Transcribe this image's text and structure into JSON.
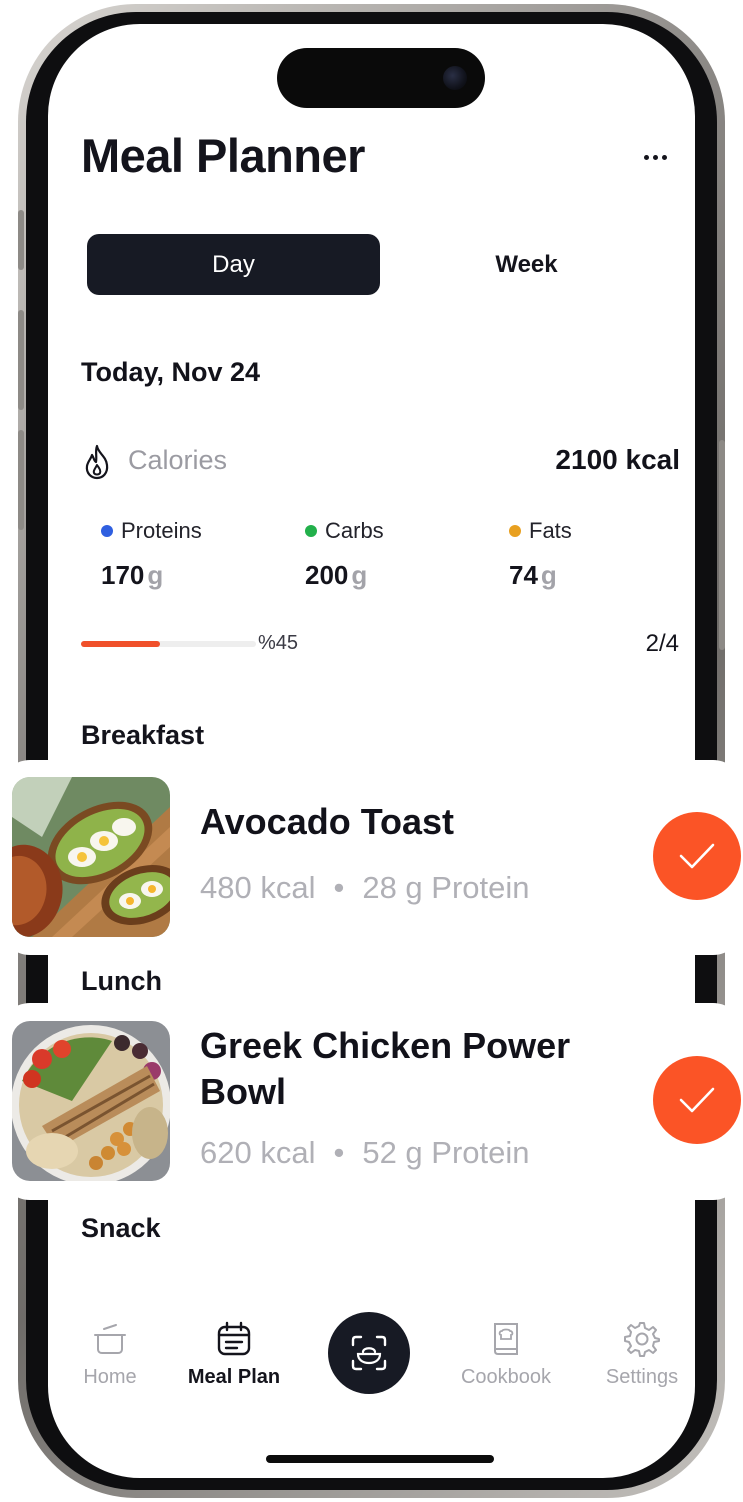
{
  "header": {
    "title": "Meal Planner",
    "more_icon": "more-horizontal-icon"
  },
  "segment": {
    "day_label": "Day",
    "week_label": "Week",
    "selected": "Day"
  },
  "date_heading": "Today, Nov 24",
  "calories": {
    "icon": "flame-icon",
    "label": "Calories",
    "value": "2100 kcal"
  },
  "macros": [
    {
      "name": "Proteins",
      "amount": "170",
      "unit": "g",
      "color": "#2f5fe0"
    },
    {
      "name": "Carbs",
      "amount": "200",
      "unit": "g",
      "color": "#22b04b"
    },
    {
      "name": "Fats",
      "amount": "74",
      "unit": "g",
      "color": "#e8a020"
    }
  ],
  "progress": {
    "fraction": 0.45,
    "percent_label": "%45",
    "count_label": "2/4",
    "color": "#f0502a"
  },
  "sections": {
    "breakfast": "Breakfast",
    "lunch": "Lunch",
    "snack": "Snack"
  },
  "meals": [
    {
      "name": "Avocado Toast",
      "kcal": "480 kcal",
      "separator": "•",
      "protein": "28 g Protein",
      "completed": true,
      "image": "avocado-toast-photo"
    },
    {
      "name": "Greek Chicken Power Bowl",
      "kcal": "620 kcal",
      "separator": "•",
      "protein": "52 g Protein",
      "completed": true,
      "image": "chicken-bowl-photo"
    }
  ],
  "colors": {
    "accent": "#fb5426",
    "dark": "#171a24"
  },
  "tabbar": {
    "home": "Home",
    "meal_plan": "Meal Plan",
    "cookbook": "Cookbook",
    "settings": "Settings",
    "active": "Meal Plan",
    "scan_icon": "scan-food-icon"
  }
}
